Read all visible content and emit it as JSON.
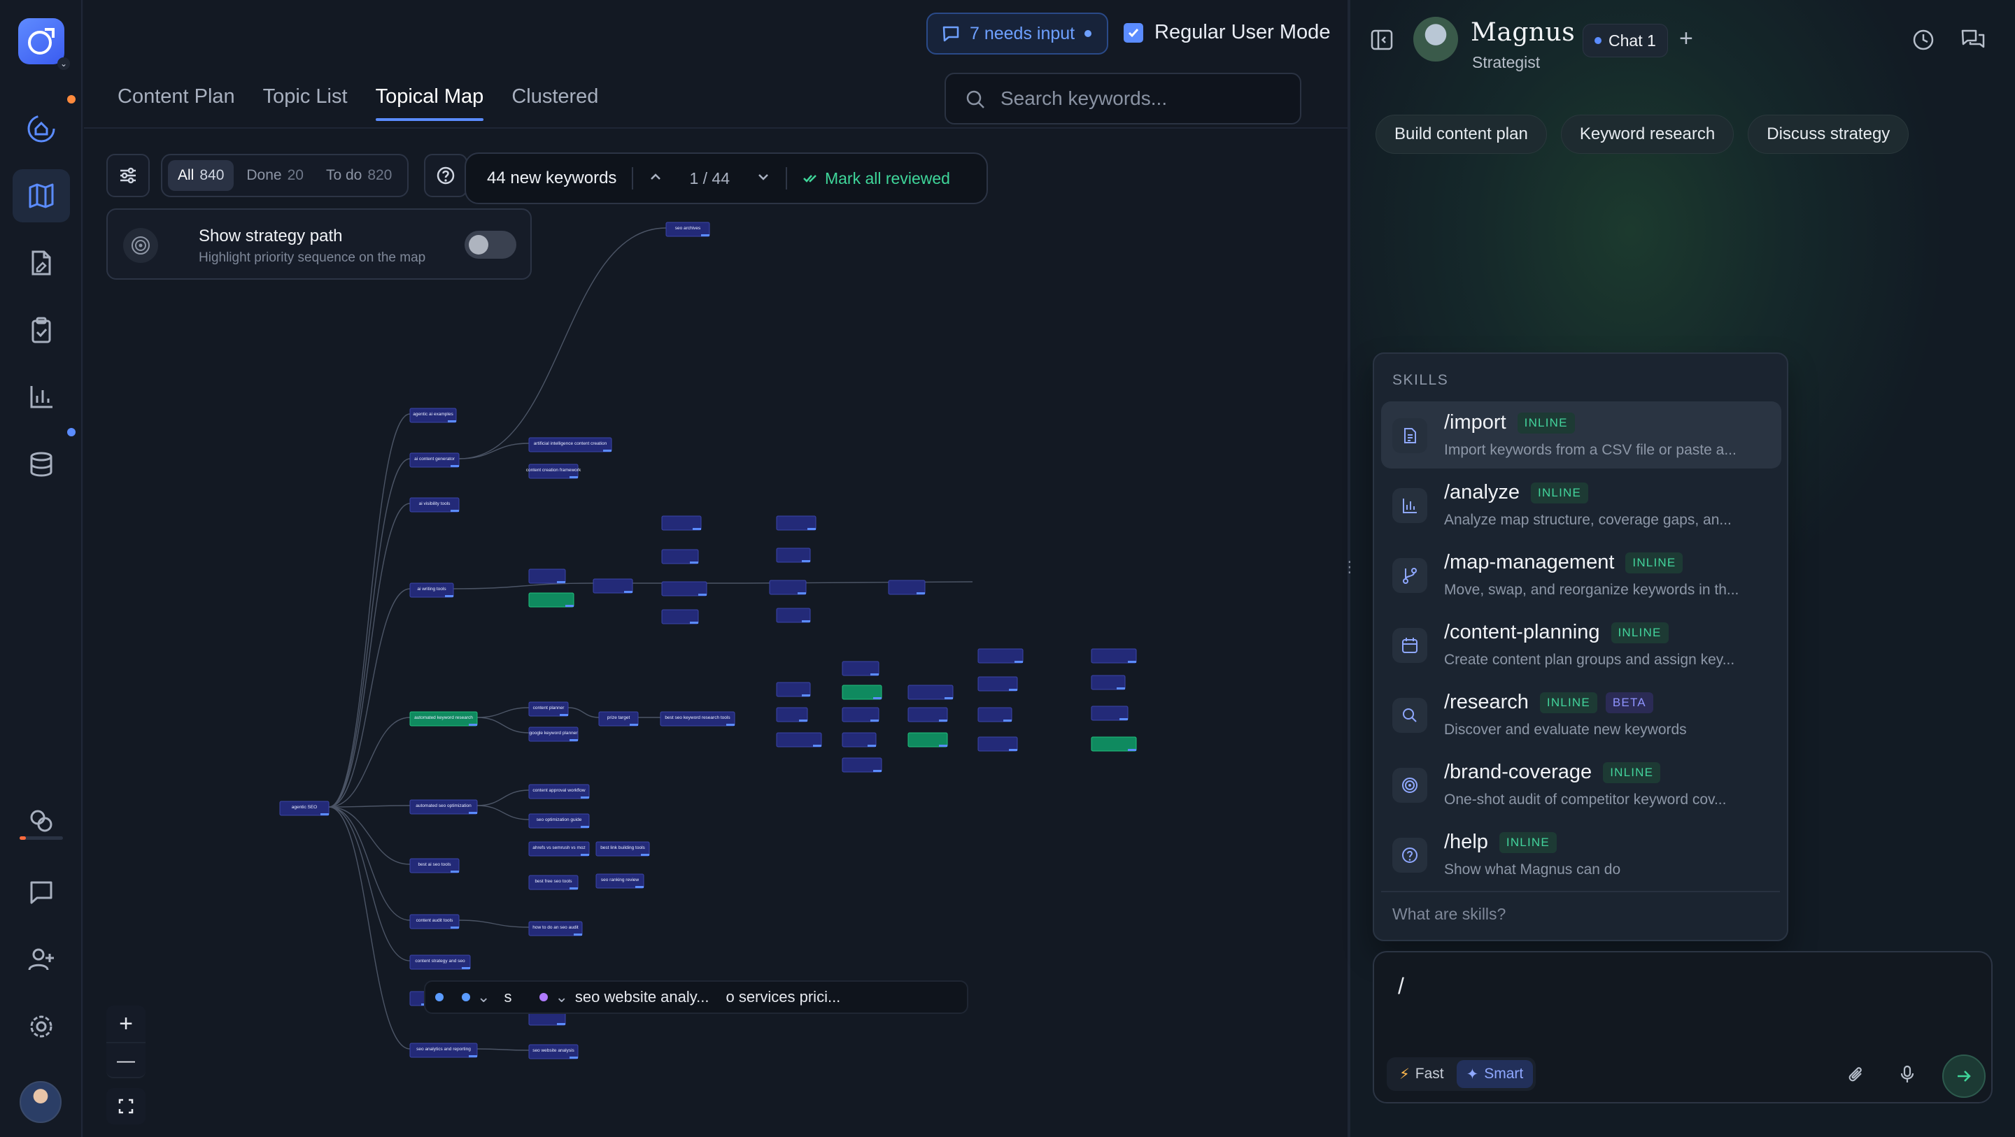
{
  "header": {
    "needs_input": "7 needs input",
    "user_mode": "Regular User Mode"
  },
  "tabs": [
    {
      "label": "Content Plan",
      "active": false
    },
    {
      "label": "Topic List",
      "active": false
    },
    {
      "label": "Topical Map",
      "active": true
    },
    {
      "label": "Clustered",
      "active": false
    }
  ],
  "search": {
    "placeholder": "Search keywords..."
  },
  "filters": {
    "all_label": "All",
    "all_count": "840",
    "done_label": "Done",
    "done_count": "20",
    "todo_label": "To do",
    "todo_count": "820"
  },
  "review_bar": {
    "new_keywords": "44 new keywords",
    "pager": "1 / 44",
    "mark_all": "Mark all reviewed"
  },
  "strategy_path": {
    "title": "Show strategy path",
    "subtitle": "Highlight priority sequence on the map",
    "enabled": false
  },
  "floating_bar": {
    "s": "s",
    "item1": "seo website analy...",
    "item2": "o services prici..."
  },
  "map_nodes": [
    "agentic SEO",
    "seo archives",
    "agentic ai examples",
    "ai content generator",
    "artificial intelligence content creation",
    "content creation framework",
    "ai visibility tools",
    "ai writing tools",
    "automated keyword research",
    "content planner",
    "google keyword planner",
    "prize target",
    "best seo keyword research tools",
    "automated seo optimization",
    "content approval workflow",
    "seo optimization guide",
    "best ai seo tools",
    "ahrefs vs semrush vs moz",
    "best link building tools",
    "best free seo tools",
    "seo ranking review",
    "content audit tools",
    "how to do an seo audit",
    "content strategy and seo",
    "seo analytics and reporting",
    "seo website analysis"
  ],
  "zoom": {
    "in": "+",
    "out": "—"
  },
  "chat": {
    "agent_name": "Magnus",
    "agent_role": "Strategist",
    "chat_tab": "Chat 1",
    "suggestions": [
      "Build content plan",
      "Keyword research",
      "Discuss strategy"
    ],
    "skills_heading": "SKILLS",
    "skills": [
      {
        "cmd": "/import",
        "tag": "INLINE",
        "beta": "",
        "desc": "Import keywords from a CSV file or paste a...",
        "icon": "file-icon"
      },
      {
        "cmd": "/analyze",
        "tag": "INLINE",
        "beta": "",
        "desc": "Analyze map structure, coverage gaps, an...",
        "icon": "bar-chart-icon"
      },
      {
        "cmd": "/map-management",
        "tag": "INLINE",
        "beta": "",
        "desc": "Move, swap, and reorganize keywords in th...",
        "icon": "git-branch-icon"
      },
      {
        "cmd": "/content-planning",
        "tag": "INLINE",
        "beta": "",
        "desc": "Create content plan groups and assign key...",
        "icon": "calendar-icon"
      },
      {
        "cmd": "/research",
        "tag": "INLINE",
        "beta": "BETA",
        "desc": "Discover and evaluate new keywords",
        "icon": "search-icon"
      },
      {
        "cmd": "/brand-coverage",
        "tag": "INLINE",
        "beta": "",
        "desc": "One-shot audit of competitor keyword cov...",
        "icon": "target-icon"
      },
      {
        "cmd": "/help",
        "tag": "INLINE",
        "beta": "",
        "desc": "Show what Magnus can do",
        "icon": "help-circle-icon"
      }
    ],
    "skills_footer": "What are skills?",
    "composer_value": "/",
    "mode_fast": "Fast",
    "mode_smart": "Smart"
  },
  "colors": {
    "accent": "#5b8cff",
    "success": "#3fd69a",
    "node": "#232a78",
    "node_green": "#0f8a5f"
  }
}
